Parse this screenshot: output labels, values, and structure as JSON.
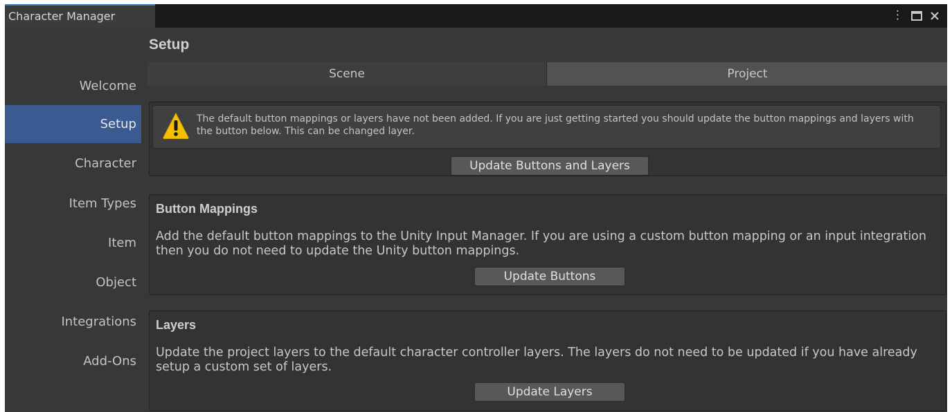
{
  "window": {
    "title": "Character Manager",
    "controls": {
      "menu_icon": "⋮",
      "maximize_icon": "☐",
      "close_icon": "✕"
    }
  },
  "sidebar": {
    "items": [
      {
        "label": "Welcome",
        "active": false
      },
      {
        "label": "Setup",
        "active": true
      },
      {
        "label": "Character",
        "active": false
      },
      {
        "label": "Item Types",
        "active": false
      },
      {
        "label": "Item",
        "active": false
      },
      {
        "label": "Object",
        "active": false
      },
      {
        "label": "Integrations",
        "active": false
      },
      {
        "label": "Add-Ons",
        "active": false
      }
    ]
  },
  "main": {
    "title": "Setup",
    "tabs": [
      {
        "label": "Scene",
        "selected": true
      },
      {
        "label": "Project",
        "selected": false
      }
    ],
    "warning": {
      "icon": "warning-icon",
      "text": "The default button mappings or layers have not been added. If you are just getting started you should update the button mappings and layers with the button below. This can be changed layer.",
      "button_label": "Update Buttons and Layers"
    },
    "button_mappings": {
      "title": "Button Mappings",
      "text": "Add the default button mappings to the Unity Input Manager. If you are using a custom button mapping or an input integration then you do not need to update the Unity button mappings.",
      "button_label": "Update Buttons"
    },
    "layers": {
      "title": "Layers",
      "text": "Update the project layers to the default character controller layers. The layers do not need to be updated if you have already setup a custom set of layers.",
      "button_label": "Update Layers"
    }
  },
  "colors": {
    "accent": "#3a5a91",
    "warning_yellow": "#f5c000",
    "background": "#383838"
  }
}
